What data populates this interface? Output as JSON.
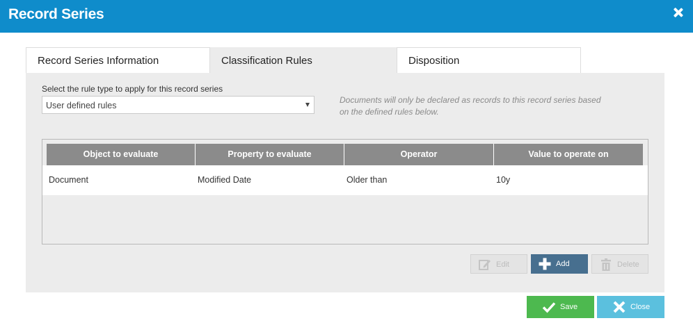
{
  "dialog": {
    "title": "Record Series",
    "close_icon": "close-icon"
  },
  "tabs": [
    {
      "label": "Record Series Information",
      "active": false
    },
    {
      "label": "Classification Rules",
      "active": true
    },
    {
      "label": "Disposition",
      "active": false
    }
  ],
  "rules": {
    "type_label": "Select the rule type to apply for this record series",
    "type_selected": "User defined rules",
    "info_text": "Documents will only be declared as records to this record series based on the defined rules below."
  },
  "table": {
    "columns": [
      "Object to evaluate",
      "Property to evaluate",
      "Operator",
      "Value to operate on"
    ],
    "rows": [
      [
        "Document",
        "Modified Date",
        "Older than",
        "10y"
      ]
    ]
  },
  "actions": {
    "edit_label": "Edit",
    "add_label": "Add",
    "delete_label": "Delete"
  },
  "footer": {
    "save_label": "Save",
    "close_label": "Close"
  },
  "colors": {
    "header": "#0f8ccb",
    "add_button": "#476f8f",
    "save_button": "#4db94f",
    "close_button": "#5bc0de"
  }
}
